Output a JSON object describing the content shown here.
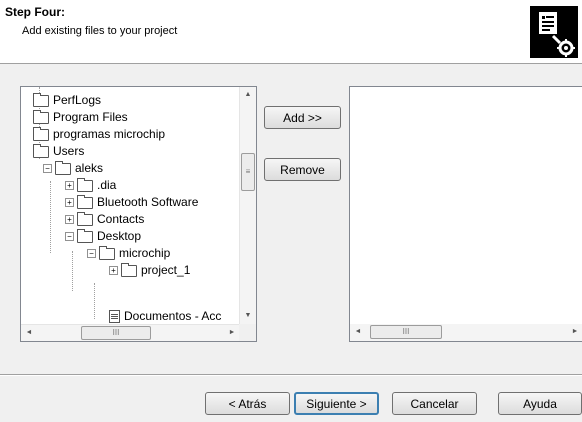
{
  "header": {
    "step_title": "Step Four:",
    "step_subtitle": "Add existing files to your project",
    "icon": "document-gear-icon"
  },
  "tree": {
    "items": [
      {
        "label": "PerfLogs",
        "icon": "folder-icon",
        "expander": ""
      },
      {
        "label": "Program Files",
        "icon": "folder-icon",
        "expander": ""
      },
      {
        "label": "programas microchip",
        "icon": "folder-icon",
        "expander": ""
      },
      {
        "label": "Users",
        "icon": "folder-icon",
        "expander": ""
      },
      {
        "label": "aleks",
        "icon": "folder-icon",
        "expander": "−"
      },
      {
        "label": ".dia",
        "icon": "folder-icon",
        "expander": "+"
      },
      {
        "label": "Bluetooth Software",
        "icon": "folder-icon",
        "expander": "+"
      },
      {
        "label": "Contacts",
        "icon": "folder-icon",
        "expander": "+"
      },
      {
        "label": "Desktop",
        "icon": "folder-icon",
        "expander": "−"
      },
      {
        "label": "microchip",
        "icon": "folder-icon",
        "expander": "−"
      },
      {
        "label": "project_1",
        "icon": "folder-icon",
        "expander": "+"
      },
      {
        "label": "Documentos - Acc",
        "icon": "document-icon",
        "expander": ""
      }
    ],
    "scroll_glyphs": {
      "up": "▲",
      "down": "▼",
      "left": "◄",
      "right": "►",
      "grip_v": "≡",
      "grip_h": "III"
    }
  },
  "buttons": {
    "add": "Add >>",
    "remove": "Remove"
  },
  "footer": {
    "back": "< Atrás",
    "next": "Siguiente >",
    "cancel": "Cancelar",
    "help": "Ayuda"
  }
}
